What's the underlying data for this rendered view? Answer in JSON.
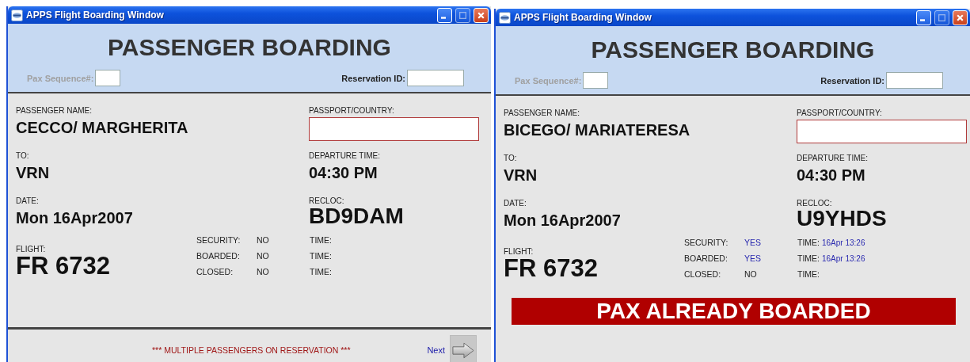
{
  "windows": [
    {
      "title": "APPS Flight Boarding Window",
      "heading": "PASSENGER BOARDING",
      "pax_sequence": {
        "label": "Pax Sequence#:",
        "disabled": true
      },
      "reservation": {
        "label": "Reservation ID:"
      },
      "fields": [
        {
          "label": "PASSENGER NAME:",
          "value": "CECCO/ MARGHERITA"
        },
        {
          "label": "PASSPORT/COUNTRY:",
          "kind": "input"
        },
        {
          "label": "TO:",
          "value": "VRN"
        },
        {
          "label": "DEPARTURE TIME:",
          "value": "04:30 PM"
        },
        {
          "label": "DATE:",
          "value": "Mon 16Apr2007"
        },
        {
          "label": "RECLOC:",
          "value": "BD9DAM",
          "kind": "large"
        }
      ],
      "flight": {
        "label": "FLIGHT:",
        "value": "FR 6732"
      },
      "statuses": [
        {
          "label": "SECURITY:",
          "value": "NO",
          "confirmed": false,
          "time_label": "TIME:"
        },
        {
          "label": "BOARDED:",
          "value": "NO",
          "confirmed": false,
          "time_label": "TIME:"
        },
        {
          "label": "CLOSED:",
          "value": "NO",
          "confirmed": false,
          "time_label": "TIME:"
        }
      ],
      "footer": {
        "message": "*** MULTIPLE PASSENGERS ON RESERVATION ***",
        "next": "Next"
      }
    },
    {
      "title": "APPS Flight Boarding Window",
      "heading": "PASSENGER BOARDING",
      "pax_sequence": {
        "label": "Pax Sequence#:",
        "disabled": true
      },
      "reservation": {
        "label": "Reservation ID:"
      },
      "fields": [
        {
          "label": "PASSENGER NAME:",
          "value": "BICEGO/ MARIATERESA"
        },
        {
          "label": "PASSPORT/COUNTRY:",
          "kind": "input"
        },
        {
          "label": "TO:",
          "value": "VRN"
        },
        {
          "label": "DEPARTURE TIME:",
          "value": "04:30 PM"
        },
        {
          "label": "DATE:",
          "value": "Mon 16Apr2007"
        },
        {
          "label": "RECLOC:",
          "value": "U9YHDS",
          "kind": "large"
        }
      ],
      "flight": {
        "label": "FLIGHT:",
        "value": "FR 6732"
      },
      "statuses": [
        {
          "label": "SECURITY:",
          "value": "YES",
          "confirmed": true,
          "time_label": "TIME:",
          "time": "16Apr 13:26"
        },
        {
          "label": "BOARDED:",
          "value": "YES",
          "confirmed": true,
          "time_label": "TIME:",
          "time": "16Apr 13:26"
        },
        {
          "label": "CLOSED:",
          "value": "NO",
          "confirmed": false,
          "time_label": "TIME:"
        }
      ],
      "alert": "PAX ALREADY BOARDED"
    }
  ]
}
